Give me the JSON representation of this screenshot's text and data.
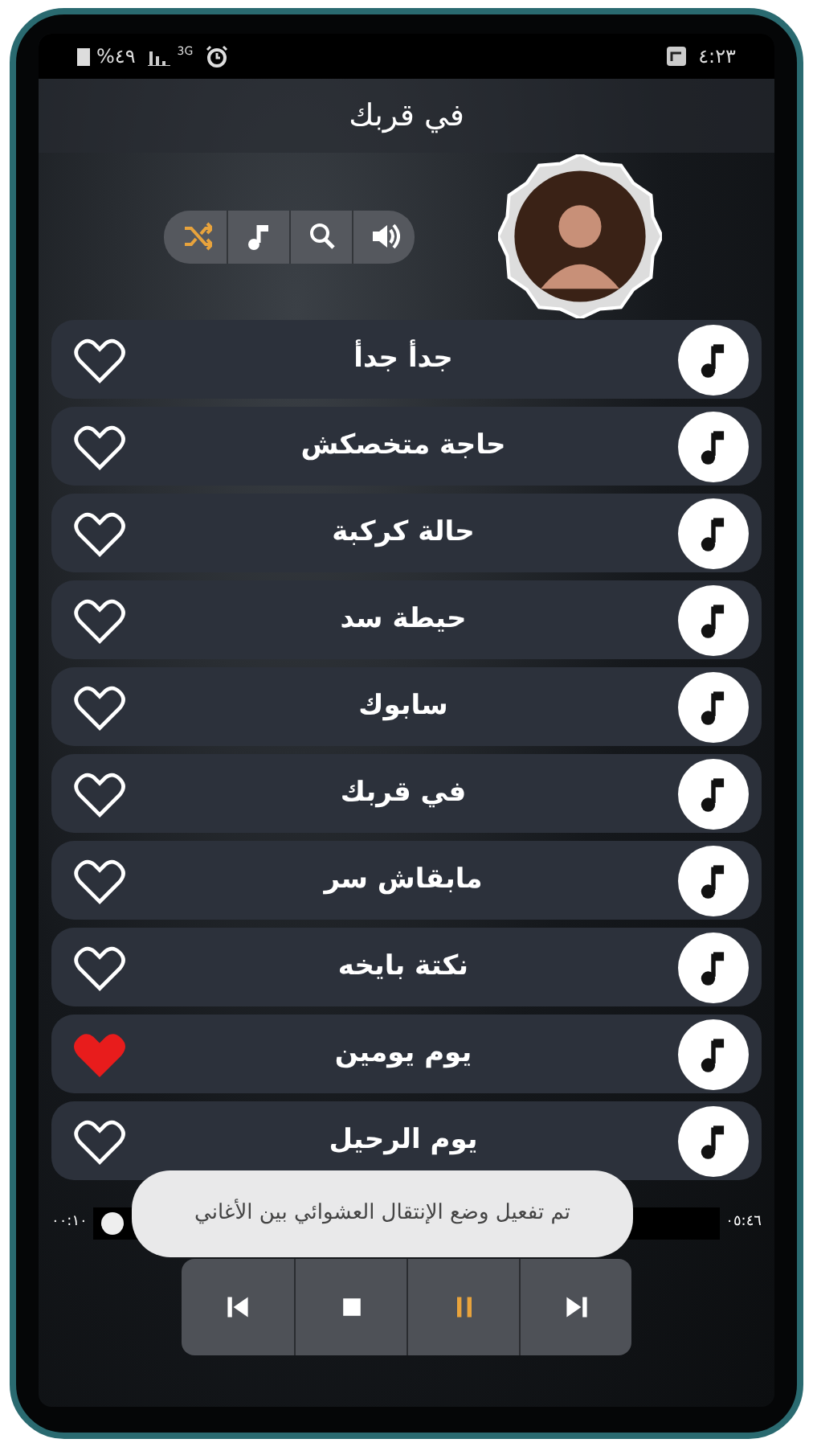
{
  "status_bar": {
    "battery": "%٤٩",
    "network": "3G",
    "time": "٤:٢٣"
  },
  "title": "في قربك",
  "toolbar": [
    {
      "kind": "shuffle",
      "selected": true
    },
    {
      "kind": "playlist",
      "selected": false
    },
    {
      "kind": "search",
      "selected": false
    },
    {
      "kind": "volume",
      "selected": false
    }
  ],
  "songs": [
    {
      "title": "جدأ جدأ",
      "favorite": false
    },
    {
      "title": "حاجة متخصكش",
      "favorite": false
    },
    {
      "title": "حالة كركبة",
      "favorite": false
    },
    {
      "title": "حيطة سد",
      "favorite": false
    },
    {
      "title": "سابوك",
      "favorite": false
    },
    {
      "title": "في قربك",
      "favorite": false
    },
    {
      "title": "مابقاش سر",
      "favorite": false
    },
    {
      "title": "نكتة بايخه",
      "favorite": false
    },
    {
      "title": "يوم يومين",
      "favorite": true
    },
    {
      "title": "يوم الرحيل",
      "favorite": false
    }
  ],
  "player": {
    "elapsed": "٠٠:١٠",
    "duration": "٠٥:٤٦",
    "level": 0.03,
    "controls": [
      {
        "kind": "previous",
        "selected": false
      },
      {
        "kind": "stop",
        "selected": false
      },
      {
        "kind": "pause",
        "selected": true
      },
      {
        "kind": "next",
        "selected": false
      }
    ]
  },
  "toast": "تم تفعيل وضع الإنتقال العشوائي بين الأغاني"
}
